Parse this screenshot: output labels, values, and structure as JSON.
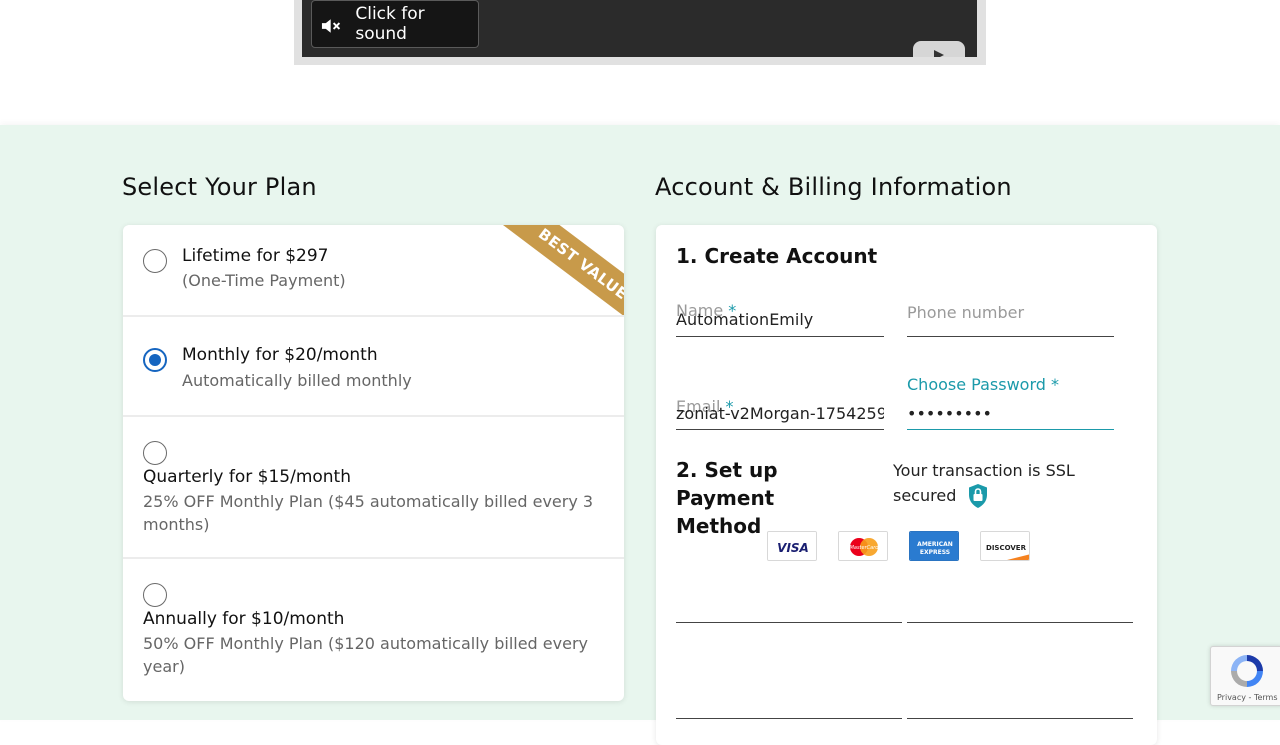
{
  "video": {
    "sound_label": "Click for sound"
  },
  "plans_section": {
    "heading": "Select Your Plan",
    "ribbon": "BEST VALUE",
    "plans": [
      {
        "title": "Lifetime for $297",
        "sub": "(One-Time Payment)",
        "selected": false
      },
      {
        "title": "Monthly for $20/month",
        "sub": "Automatically billed monthly",
        "selected": true
      },
      {
        "title": "Quarterly for $15/month",
        "sub": "25% OFF Monthly Plan ($45 automatically billed every 3 months)",
        "selected": false
      },
      {
        "title": "Annually for $10/month",
        "sub": "50% OFF Monthly Plan ($120 automatically billed every year)",
        "selected": false
      }
    ]
  },
  "billing": {
    "heading": "Account & Billing Information",
    "step1": "1. Create Account",
    "name_label": "Name",
    "name_value": "AutomationEmily",
    "phone_label": "Phone number",
    "email_label": "Email",
    "email_value": "zoniat-v2Morgan-1754259",
    "password_label": "Choose Password",
    "password_value": "•••••••••",
    "required_mark": "*",
    "step2": "2. Set up Payment Method",
    "ssl_text": "Your transaction is SSL secured",
    "cards": [
      "VISA",
      "MasterCard",
      "AMERICAN EXPRESS",
      "DISCOVER"
    ]
  },
  "recaptcha": {
    "links": "Privacy - Terms"
  },
  "colors": {
    "section_bg": "#e8f6ee",
    "accent": "#1b9aaa",
    "radio_selected": "#1565c0",
    "ribbon": "#c89a4a"
  }
}
